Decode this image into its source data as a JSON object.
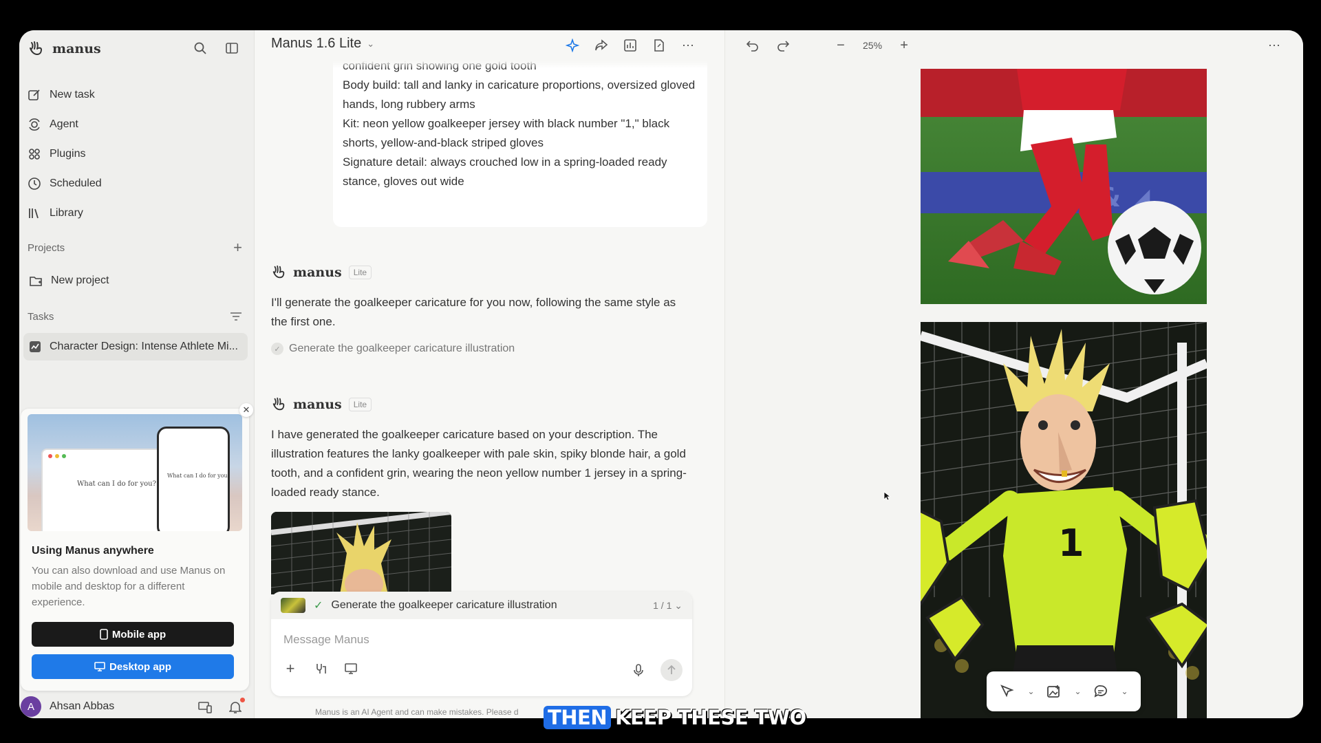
{
  "sidebar": {
    "brand": "manus",
    "nav": [
      {
        "label": "New task",
        "icon": "edit-icon"
      },
      {
        "label": "Agent",
        "icon": "agent-icon"
      },
      {
        "label": "Plugins",
        "icon": "plugins-icon"
      },
      {
        "label": "Scheduled",
        "icon": "clock-icon"
      },
      {
        "label": "Library",
        "icon": "library-icon"
      }
    ],
    "projects_label": "Projects",
    "new_project": "New project",
    "tasks_label": "Tasks",
    "task_item": "Character Design: Intense Athlete Mi...",
    "promo": {
      "laptop_text": "What can I do for you?",
      "phone_text": "What can I do for you",
      "title": "Using Manus anywhere",
      "body": "You can also download and use Manus on mobile and desktop for a different experience.",
      "mobile_btn": "Mobile app",
      "desktop_btn": "Desktop app"
    },
    "user": {
      "initial": "A",
      "name": "Ahsan Abbas"
    }
  },
  "chat": {
    "model": "Manus 1.6 Lite",
    "bubble_lines": [
      "Face: pale skin, tall spiky blonde hair, long narrow nose, wide confident grin showing one gold tooth",
      "Body build: tall and lanky in caricature proportions, oversized gloved hands, long rubbery arms",
      "Kit: neon yellow goalkeeper jersey with black number \"1,\" black shorts, yellow-and-black striped gloves",
      "Signature detail: always crouched low in a spring-loaded ready stance, gloves out wide"
    ],
    "agent_name": "manus",
    "badge": "Lite",
    "msg1": "I'll generate the goalkeeper caricature for you now, following the same style as the first one.",
    "step1": "Generate the goalkeeper caricature illustration",
    "msg2": "I have generated the goalkeeper caricature based on your description. The illustration features the lanky goalkeeper with pale skin, spiky blonde hair, a gold tooth, and a confident grin, wearing the neon yellow number 1 jersey in a spring-loaded ready stance.",
    "task_strip": "Generate the goalkeeper caricature illustration",
    "task_count": "1 / 1",
    "placeholder": "Message Manus",
    "disclaimer": "Manus is an AI Agent and can make mistakes. Please d"
  },
  "canvas": {
    "zoom": "25%"
  },
  "caption": {
    "highlight": "THEN",
    "rest": "KEEP THESE TWO"
  },
  "colors": {
    "accent_blue": "#1f7ae8",
    "caption_blue": "#1f6de6",
    "avatar_purple": "#6a3fa0"
  }
}
